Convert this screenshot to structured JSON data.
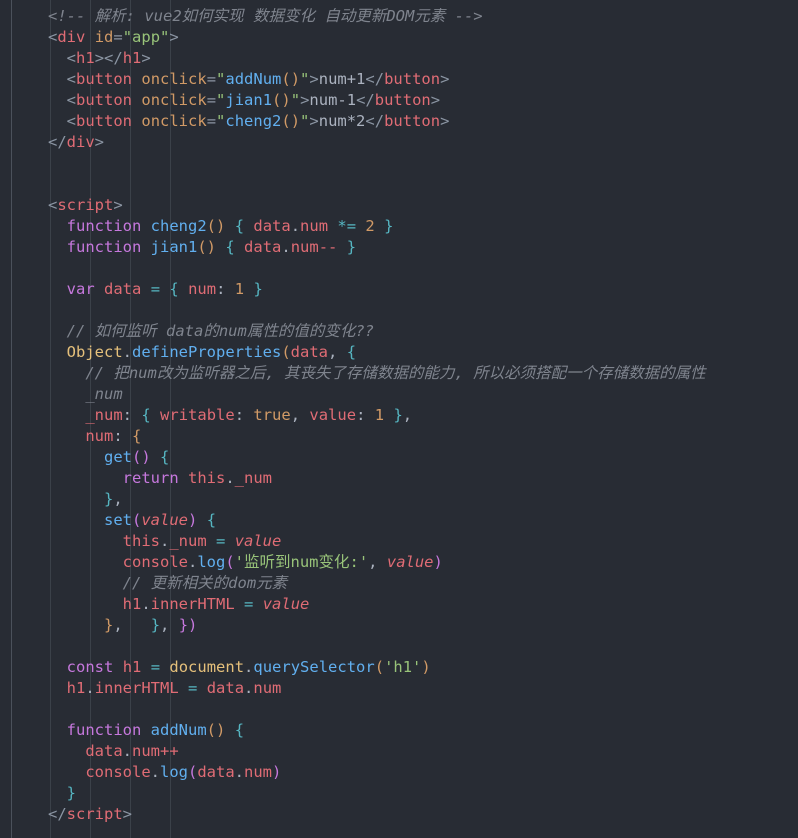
{
  "editor": {
    "background_color": "#282c34",
    "font_size_px": 15.5,
    "line_height_px": 21,
    "clipped_top_fragment": ">"
  },
  "theme": {
    "comment": "#7f848e",
    "tag": "#e06c75",
    "attribute": "#d19a66",
    "string": "#98c379",
    "function": "#61afef",
    "keyword": "#c678dd",
    "variable": "#e06c75",
    "object": "#e5c07b",
    "number": "#d19a66",
    "punctuation": "#abb2bf",
    "operator": "#56b6c2"
  },
  "code": {
    "language": "html",
    "lines": [
      {
        "indent": 0,
        "tokens": [
          {
            "t": "comment",
            "v": "<!-- 解析: vue2如何实现 数据变化 自动更新DOM元素 -->"
          }
        ]
      },
      {
        "indent": 0,
        "tokens": [
          {
            "t": "bracket",
            "v": "<"
          },
          {
            "t": "tag",
            "v": "div"
          },
          {
            "t": "plain",
            "v": " "
          },
          {
            "t": "attr",
            "v": "id"
          },
          {
            "t": "bracket",
            "v": "="
          },
          {
            "t": "string",
            "v": "\"app\""
          },
          {
            "t": "bracket",
            "v": ">"
          }
        ]
      },
      {
        "indent": 1,
        "tokens": [
          {
            "t": "bracket",
            "v": "<"
          },
          {
            "t": "tag",
            "v": "h1"
          },
          {
            "t": "bracket",
            "v": "></"
          },
          {
            "t": "tag",
            "v": "h1"
          },
          {
            "t": "bracket",
            "v": ">"
          }
        ]
      },
      {
        "indent": 1,
        "tokens": [
          {
            "t": "bracket",
            "v": "<"
          },
          {
            "t": "tag",
            "v": "button"
          },
          {
            "t": "plain",
            "v": " "
          },
          {
            "t": "attr",
            "v": "onclick"
          },
          {
            "t": "bracket",
            "v": "="
          },
          {
            "t": "string",
            "v": "\""
          },
          {
            "t": "fn",
            "v": "addNum"
          },
          {
            "t": "paren-o",
            "v": "()"
          },
          {
            "t": "string",
            "v": "\""
          },
          {
            "t": "bracket",
            "v": ">"
          },
          {
            "t": "text",
            "v": "num+1"
          },
          {
            "t": "bracket",
            "v": "</"
          },
          {
            "t": "tag",
            "v": "button"
          },
          {
            "t": "bracket",
            "v": ">"
          }
        ]
      },
      {
        "indent": 1,
        "tokens": [
          {
            "t": "bracket",
            "v": "<"
          },
          {
            "t": "tag",
            "v": "button"
          },
          {
            "t": "plain",
            "v": " "
          },
          {
            "t": "attr",
            "v": "onclick"
          },
          {
            "t": "bracket",
            "v": "="
          },
          {
            "t": "string",
            "v": "\""
          },
          {
            "t": "fn",
            "v": "jian1"
          },
          {
            "t": "paren-o",
            "v": "()"
          },
          {
            "t": "string",
            "v": "\""
          },
          {
            "t": "bracket",
            "v": ">"
          },
          {
            "t": "text",
            "v": "num-1"
          },
          {
            "t": "bracket",
            "v": "</"
          },
          {
            "t": "tag",
            "v": "button"
          },
          {
            "t": "bracket",
            "v": ">"
          }
        ]
      },
      {
        "indent": 1,
        "tokens": [
          {
            "t": "bracket",
            "v": "<"
          },
          {
            "t": "tag",
            "v": "button"
          },
          {
            "t": "plain",
            "v": " "
          },
          {
            "t": "attr",
            "v": "onclick"
          },
          {
            "t": "bracket",
            "v": "="
          },
          {
            "t": "string",
            "v": "\""
          },
          {
            "t": "fn",
            "v": "cheng2"
          },
          {
            "t": "paren-o",
            "v": "()"
          },
          {
            "t": "string",
            "v": "\""
          },
          {
            "t": "bracket",
            "v": ">"
          },
          {
            "t": "text",
            "v": "num*2"
          },
          {
            "t": "bracket",
            "v": "</"
          },
          {
            "t": "tag",
            "v": "button"
          },
          {
            "t": "bracket",
            "v": ">"
          }
        ]
      },
      {
        "indent": 0,
        "tokens": [
          {
            "t": "bracket",
            "v": "</"
          },
          {
            "t": "tag",
            "v": "div"
          },
          {
            "t": "bracket",
            "v": ">"
          }
        ]
      },
      {
        "indent": 0,
        "tokens": []
      },
      {
        "indent": 0,
        "tokens": []
      },
      {
        "indent": 0,
        "tokens": [
          {
            "t": "bracket",
            "v": "<"
          },
          {
            "t": "tag",
            "v": "script"
          },
          {
            "t": "bracket",
            "v": ">"
          }
        ]
      },
      {
        "indent": 1,
        "tokens": [
          {
            "t": "kw",
            "v": "function"
          },
          {
            "t": "plain",
            "v": " "
          },
          {
            "t": "fn",
            "v": "cheng2"
          },
          {
            "t": "paren-o",
            "v": "()"
          },
          {
            "t": "plain",
            "v": " "
          },
          {
            "t": "brace-c",
            "v": "{"
          },
          {
            "t": "plain",
            "v": " "
          },
          {
            "t": "var",
            "v": "data"
          },
          {
            "t": "punct",
            "v": "."
          },
          {
            "t": "var",
            "v": "num"
          },
          {
            "t": "plain",
            "v": " "
          },
          {
            "t": "op",
            "v": "*="
          },
          {
            "t": "plain",
            "v": " "
          },
          {
            "t": "num",
            "v": "2"
          },
          {
            "t": "plain",
            "v": " "
          },
          {
            "t": "brace-c",
            "v": "}"
          }
        ]
      },
      {
        "indent": 1,
        "tokens": [
          {
            "t": "kw",
            "v": "function"
          },
          {
            "t": "plain",
            "v": " "
          },
          {
            "t": "fn",
            "v": "jian1"
          },
          {
            "t": "paren-o",
            "v": "()"
          },
          {
            "t": "plain",
            "v": " "
          },
          {
            "t": "brace-c",
            "v": "{"
          },
          {
            "t": "plain",
            "v": " "
          },
          {
            "t": "var",
            "v": "data"
          },
          {
            "t": "punct",
            "v": "."
          },
          {
            "t": "var",
            "v": "num--"
          },
          {
            "t": "plain",
            "v": " "
          },
          {
            "t": "brace-c",
            "v": "}"
          }
        ]
      },
      {
        "indent": 0,
        "tokens": []
      },
      {
        "indent": 1,
        "tokens": [
          {
            "t": "kw",
            "v": "var"
          },
          {
            "t": "plain",
            "v": " "
          },
          {
            "t": "var",
            "v": "data"
          },
          {
            "t": "plain",
            "v": " "
          },
          {
            "t": "op",
            "v": "="
          },
          {
            "t": "plain",
            "v": " "
          },
          {
            "t": "brace-c",
            "v": "{"
          },
          {
            "t": "plain",
            "v": " "
          },
          {
            "t": "var",
            "v": "num"
          },
          {
            "t": "punct",
            "v": ":"
          },
          {
            "t": "plain",
            "v": " "
          },
          {
            "t": "num",
            "v": "1"
          },
          {
            "t": "plain",
            "v": " "
          },
          {
            "t": "brace-c",
            "v": "}"
          }
        ]
      },
      {
        "indent": 0,
        "tokens": []
      },
      {
        "indent": 1,
        "tokens": [
          {
            "t": "comment",
            "v": "// 如何监听 data的num属性的值的变化??"
          }
        ]
      },
      {
        "indent": 1,
        "tokens": [
          {
            "t": "obj",
            "v": "Object"
          },
          {
            "t": "punct",
            "v": "."
          },
          {
            "t": "fn",
            "v": "defineProperties"
          },
          {
            "t": "paren-o",
            "v": "("
          },
          {
            "t": "var",
            "v": "data"
          },
          {
            "t": "punct",
            "v": ","
          },
          {
            "t": "plain",
            "v": " "
          },
          {
            "t": "brace-c",
            "v": "{"
          }
        ]
      },
      {
        "indent": 2,
        "tokens": [
          {
            "t": "comment",
            "v": "// 把num改为监听器之后, 其丧失了存储数据的能力, 所以必须搭配一个存储数据的属性"
          }
        ]
      },
      {
        "indent": 2,
        "tokens": [
          {
            "t": "comment",
            "v": "_num"
          }
        ]
      },
      {
        "indent": 2,
        "tokens": [
          {
            "t": "var",
            "v": "_num"
          },
          {
            "t": "punct",
            "v": ":"
          },
          {
            "t": "plain",
            "v": " "
          },
          {
            "t": "brace-c",
            "v": "{"
          },
          {
            "t": "plain",
            "v": " "
          },
          {
            "t": "var",
            "v": "writable"
          },
          {
            "t": "punct",
            "v": ":"
          },
          {
            "t": "plain",
            "v": " "
          },
          {
            "t": "const",
            "v": "true"
          },
          {
            "t": "punct",
            "v": ","
          },
          {
            "t": "plain",
            "v": " "
          },
          {
            "t": "var",
            "v": "value"
          },
          {
            "t": "punct",
            "v": ":"
          },
          {
            "t": "plain",
            "v": " "
          },
          {
            "t": "num",
            "v": "1"
          },
          {
            "t": "plain",
            "v": " "
          },
          {
            "t": "brace-c",
            "v": "}"
          },
          {
            "t": "punct",
            "v": ","
          }
        ]
      },
      {
        "indent": 2,
        "tokens": [
          {
            "t": "var",
            "v": "num"
          },
          {
            "t": "punct",
            "v": ":"
          },
          {
            "t": "plain",
            "v": " "
          },
          {
            "t": "brace-o",
            "v": "{"
          }
        ]
      },
      {
        "indent": 3,
        "tokens": [
          {
            "t": "fn",
            "v": "get"
          },
          {
            "t": "paren-p",
            "v": "()"
          },
          {
            "t": "plain",
            "v": " "
          },
          {
            "t": "brace-c",
            "v": "{"
          }
        ]
      },
      {
        "indent": 4,
        "tokens": [
          {
            "t": "kw",
            "v": "return"
          },
          {
            "t": "plain",
            "v": " "
          },
          {
            "t": "var",
            "v": "this"
          },
          {
            "t": "punct",
            "v": "."
          },
          {
            "t": "var",
            "v": "_num"
          }
        ]
      },
      {
        "indent": 3,
        "tokens": [
          {
            "t": "brace-c",
            "v": "}"
          },
          {
            "t": "punct",
            "v": ","
          }
        ]
      },
      {
        "indent": 3,
        "tokens": [
          {
            "t": "fn",
            "v": "set"
          },
          {
            "t": "paren-p",
            "v": "("
          },
          {
            "t": "param",
            "v": "value"
          },
          {
            "t": "paren-p",
            "v": ")"
          },
          {
            "t": "plain",
            "v": " "
          },
          {
            "t": "brace-c",
            "v": "{"
          }
        ]
      },
      {
        "indent": 4,
        "tokens": [
          {
            "t": "var",
            "v": "this"
          },
          {
            "t": "punct",
            "v": "."
          },
          {
            "t": "var",
            "v": "_num"
          },
          {
            "t": "plain",
            "v": " "
          },
          {
            "t": "op",
            "v": "="
          },
          {
            "t": "plain",
            "v": " "
          },
          {
            "t": "param",
            "v": "value"
          }
        ]
      },
      {
        "indent": 4,
        "tokens": [
          {
            "t": "var",
            "v": "console"
          },
          {
            "t": "punct",
            "v": "."
          },
          {
            "t": "fn",
            "v": "log"
          },
          {
            "t": "paren-p",
            "v": "("
          },
          {
            "t": "string",
            "v": "'监听到num变化:'"
          },
          {
            "t": "punct",
            "v": ","
          },
          {
            "t": "plain",
            "v": " "
          },
          {
            "t": "param",
            "v": "value"
          },
          {
            "t": "paren-p",
            "v": ")"
          }
        ]
      },
      {
        "indent": 4,
        "tokens": [
          {
            "t": "comment",
            "v": "// 更新相关的dom元素"
          }
        ]
      },
      {
        "indent": 4,
        "tokens": [
          {
            "t": "var",
            "v": "h1"
          },
          {
            "t": "punct",
            "v": "."
          },
          {
            "t": "var",
            "v": "innerHTML"
          },
          {
            "t": "plain",
            "v": " "
          },
          {
            "t": "op",
            "v": "="
          },
          {
            "t": "plain",
            "v": " "
          },
          {
            "t": "param",
            "v": "value"
          }
        ]
      },
      {
        "indent": 3,
        "tokens": [
          {
            "t": "brace-o",
            "v": "}"
          },
          {
            "t": "punct",
            "v": ","
          },
          {
            "t": "plain",
            "v": "   "
          },
          {
            "t": "brace-c",
            "v": "}"
          },
          {
            "t": "punct",
            "v": ","
          },
          {
            "t": "plain",
            "v": " "
          },
          {
            "t": "brace-p",
            "v": "})"
          }
        ]
      },
      {
        "indent": 0,
        "tokens": []
      },
      {
        "indent": 1,
        "tokens": [
          {
            "t": "kw",
            "v": "const"
          },
          {
            "t": "plain",
            "v": " "
          },
          {
            "t": "var",
            "v": "h1"
          },
          {
            "t": "plain",
            "v": " "
          },
          {
            "t": "op",
            "v": "="
          },
          {
            "t": "plain",
            "v": " "
          },
          {
            "t": "obj",
            "v": "document"
          },
          {
            "t": "punct",
            "v": "."
          },
          {
            "t": "fn",
            "v": "querySelector"
          },
          {
            "t": "paren-o",
            "v": "("
          },
          {
            "t": "string",
            "v": "'h1'"
          },
          {
            "t": "paren-o",
            "v": ")"
          }
        ]
      },
      {
        "indent": 1,
        "tokens": [
          {
            "t": "var",
            "v": "h1"
          },
          {
            "t": "punct",
            "v": "."
          },
          {
            "t": "var",
            "v": "innerHTML"
          },
          {
            "t": "plain",
            "v": " "
          },
          {
            "t": "op",
            "v": "="
          },
          {
            "t": "plain",
            "v": " "
          },
          {
            "t": "var",
            "v": "data"
          },
          {
            "t": "punct",
            "v": "."
          },
          {
            "t": "var",
            "v": "num"
          }
        ]
      },
      {
        "indent": 0,
        "tokens": []
      },
      {
        "indent": 1,
        "tokens": [
          {
            "t": "kw",
            "v": "function"
          },
          {
            "t": "plain",
            "v": " "
          },
          {
            "t": "fn",
            "v": "addNum"
          },
          {
            "t": "paren-o",
            "v": "()"
          },
          {
            "t": "plain",
            "v": " "
          },
          {
            "t": "brace-c",
            "v": "{"
          }
        ]
      },
      {
        "indent": 2,
        "tokens": [
          {
            "t": "var",
            "v": "data"
          },
          {
            "t": "punct",
            "v": "."
          },
          {
            "t": "var",
            "v": "num++"
          }
        ]
      },
      {
        "indent": 2,
        "tokens": [
          {
            "t": "var",
            "v": "console"
          },
          {
            "t": "punct",
            "v": "."
          },
          {
            "t": "fn",
            "v": "log"
          },
          {
            "t": "paren-p",
            "v": "("
          },
          {
            "t": "var",
            "v": "data"
          },
          {
            "t": "punct",
            "v": "."
          },
          {
            "t": "var",
            "v": "num"
          },
          {
            "t": "paren-p",
            "v": ")"
          }
        ]
      },
      {
        "indent": 1,
        "tokens": [
          {
            "t": "brace-c",
            "v": "}"
          }
        ]
      },
      {
        "indent": 0,
        "tokens": [
          {
            "t": "bracket",
            "v": "</"
          },
          {
            "t": "tag",
            "v": "script"
          },
          {
            "t": "bracket",
            "v": ">"
          }
        ]
      }
    ]
  }
}
